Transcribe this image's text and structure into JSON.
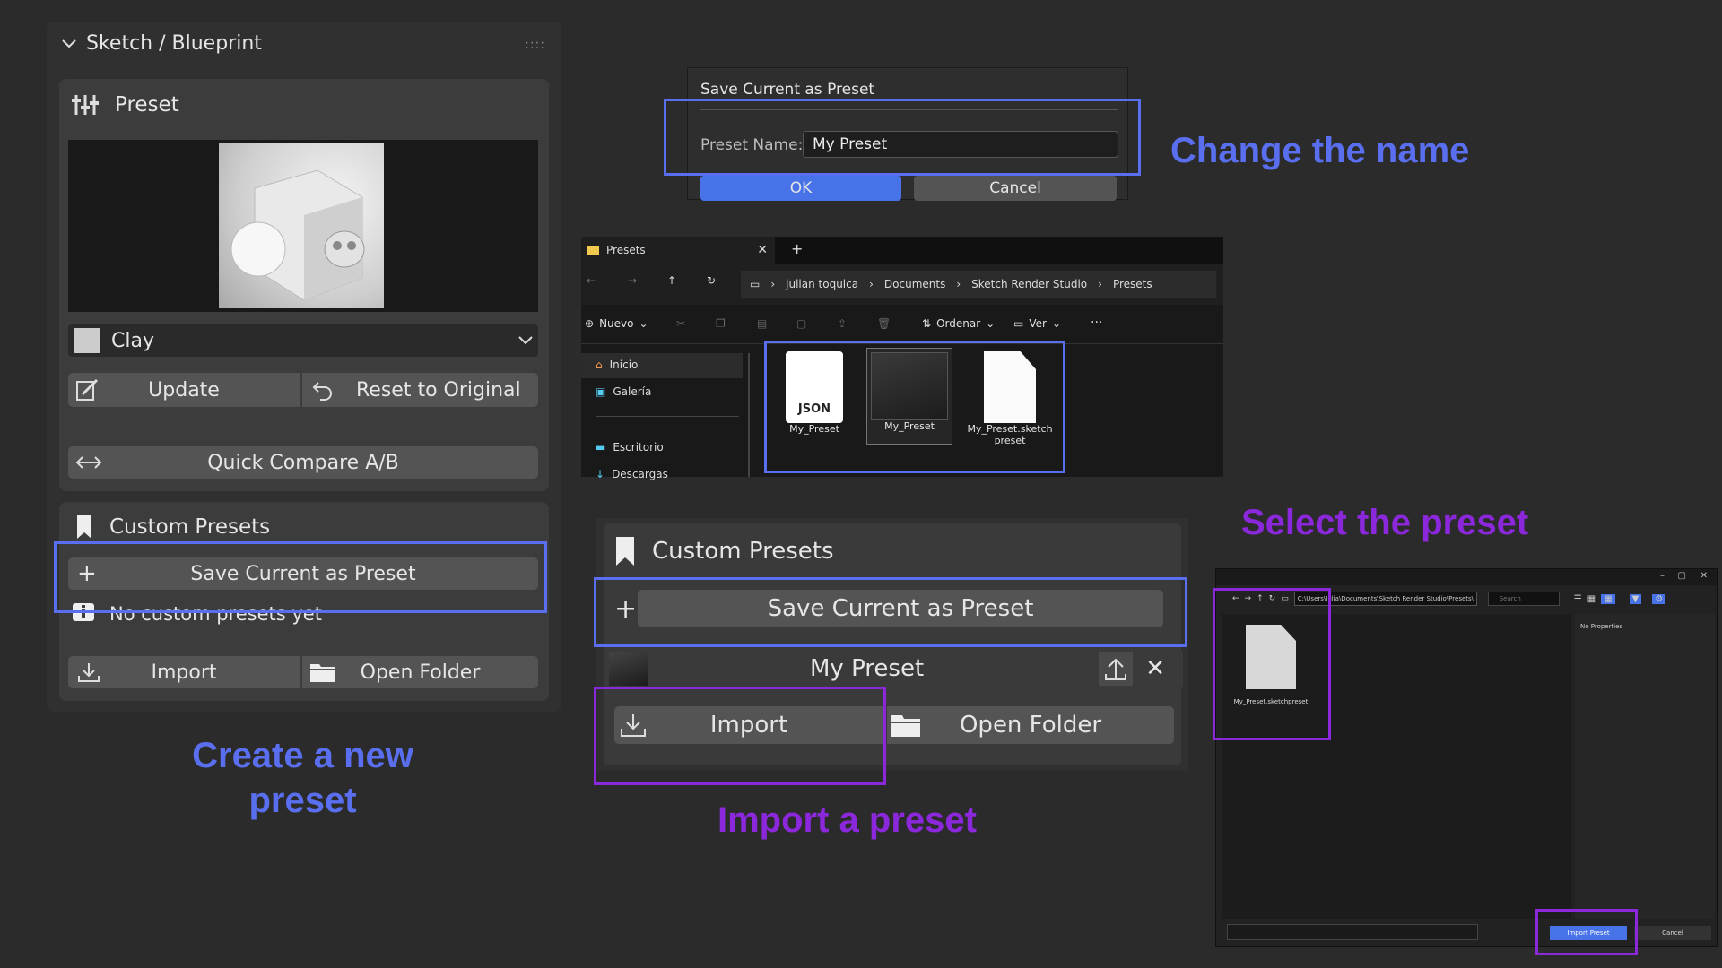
{
  "panel": {
    "title": "Sketch / Blueprint",
    "preset_header": "Preset",
    "preset_select": "Clay",
    "update_label": "Update",
    "reset_label": "Reset to Original",
    "quick_compare_label": "Quick Compare A/B",
    "custom_presets_header": "Custom Presets",
    "save_preset_label": "Save Current as Preset",
    "no_presets_text": "No custom presets yet",
    "import_label": "Import",
    "open_folder_label": "Open Folder"
  },
  "dialog": {
    "title": "Save Current as Preset",
    "name_label": "Preset Name:",
    "name_value": "My Preset",
    "ok_label": "OK",
    "cancel_label": "Cancel",
    "behind_import": "Import",
    "behind_open_folder": "Open Folder"
  },
  "explorer": {
    "tab_title": "Presets",
    "breadcrumb": [
      "julian toquica",
      "Documents",
      "Sketch Render Studio",
      "Presets"
    ],
    "toolbar": {
      "new": "Nuevo",
      "sort": "Ordenar",
      "view": "Ver"
    },
    "sidebar": [
      "Inicio",
      "Galería",
      "Escritorio",
      "Descargas"
    ],
    "files": [
      {
        "name": "My_Preset",
        "type": "JSON"
      },
      {
        "name": "My_Preset",
        "type": "image"
      },
      {
        "name": "My_Preset.sketch preset",
        "type": "doc"
      }
    ]
  },
  "custom_presets_zoom": {
    "header": "Custom Presets",
    "save_label": "Save Current as Preset",
    "preset_item": "My Preset",
    "import_label": "Import",
    "open_folder_label": "Open Folder"
  },
  "file_browser": {
    "path": "C:\\Users\\Julia\\Documents\\Sketch Render Studio\\Presets\\",
    "search_placeholder": "Search",
    "file_name": "My_Preset.sketchpreset",
    "no_properties": "No Properties",
    "import_button": "Import Preset",
    "cancel_button": "Cancel"
  },
  "captions": {
    "change_name": "Change the name",
    "select_preset": "Select the preset",
    "create_preset": "Create a new preset",
    "import_preset": "Import a preset"
  },
  "colors": {
    "blue_highlight": "#5a6ff0",
    "purple_highlight": "#8c28dc",
    "blue_caption": "#5a6ff0",
    "purple_caption": "#8c28dc",
    "ok_button": "#4772e8"
  }
}
